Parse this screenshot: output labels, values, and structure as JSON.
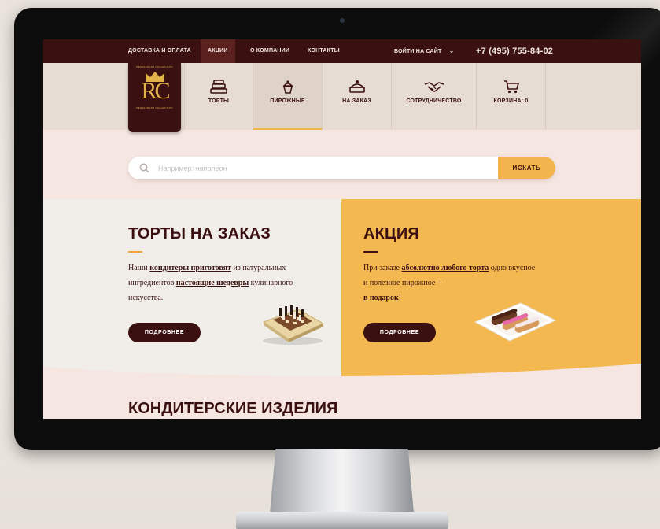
{
  "topbar": {
    "links": [
      "ДОСТАВКА И ОПЛАТА",
      "АКЦИИ",
      "О КОМПАНИИ",
      "КОНТАКТЫ"
    ],
    "login": "ВОЙТИ НА САЙТ",
    "phone": "+7 (495) 755-84-02"
  },
  "logo": {
    "tagline_top": "RESTAURANT COLLECTION",
    "monogram": "RC",
    "tagline_bottom": "RESTAURANT COLLECTION"
  },
  "nav": [
    {
      "label": "ТОРТЫ",
      "icon": "cake-layers-icon"
    },
    {
      "label": "ПИРОЖНЫЕ",
      "icon": "cupcake-icon"
    },
    {
      "label": "НА ЗАКАЗ",
      "icon": "cake-order-icon"
    },
    {
      "label": "СОТРУДНИЧЕСТВО",
      "icon": "handshake-icon"
    },
    {
      "label": "КОРЗИНА: 0",
      "icon": "cart-icon"
    }
  ],
  "search": {
    "placeholder": "Например: наполеон",
    "button": "ИСКАТЬ"
  },
  "promo_left": {
    "title": "ТОРТЫ НА ЗАКАЗ",
    "text_1": "Наши ",
    "link_1": "кондитеры приготовят",
    "text_2": " из натуральных ингредиентов ",
    "link_2": "настоящие шедевры",
    "text_3": " кулинарного искусства.",
    "button": "ПОДРОБНЕЕ"
  },
  "promo_right": {
    "title": "АКЦИЯ",
    "text_1": "При заказе ",
    "link_1": "абсолютно любого торта",
    "text_2": " одно вкусное и полезное пирожное –",
    "link_2": "в подарок",
    "text_3": "!",
    "button": "ПОДРОБНЕЕ"
  },
  "section_title": "КОНДИТЕРСКИЕ ИЗДЕЛИЯ",
  "colors": {
    "brown": "#3a1110",
    "orange": "#f2b54d",
    "beige": "#e7dcd3",
    "pink": "#f5e6e1"
  }
}
